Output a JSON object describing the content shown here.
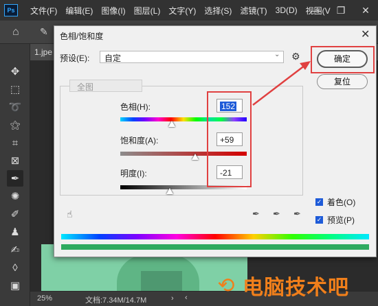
{
  "app": {
    "logo": "Ps",
    "menu": [
      "文件(F)",
      "编辑(E)",
      "图像(I)",
      "图层(L)",
      "文字(Y)",
      "选择(S)",
      "滤镜(T)",
      "3D(D)",
      "视图(V"
    ],
    "window_controls": [
      "—",
      "❐",
      "✕"
    ]
  },
  "document": {
    "tab": "1.jpe",
    "zoom": "25%",
    "info": "文档:7.34M/14.7M"
  },
  "dialog": {
    "title": "色相/饱和度",
    "close": "✕",
    "preset_label": "预设(E):",
    "preset_value": "自定",
    "ok_label": "确定",
    "reset_label": "复位",
    "channel": "全图",
    "hue_label": "色相(H):",
    "hue_value": "152",
    "hue_fraction": 0.41,
    "saturation_label": "饱和度(A):",
    "saturation_value": "+59",
    "saturation_fraction": 0.59,
    "lightness_label": "明度(I):",
    "lightness_value": "-21",
    "lightness_fraction": 0.39,
    "colorize_label": "着色(O)",
    "colorize_checked": true,
    "preview_label": "预览(P)",
    "preview_checked": true
  },
  "watermark": {
    "text": "电脑技术吧"
  },
  "colors": {
    "highlight": "#e04040",
    "selection": "#1e5bd8",
    "watermark": "#f07f1b"
  }
}
